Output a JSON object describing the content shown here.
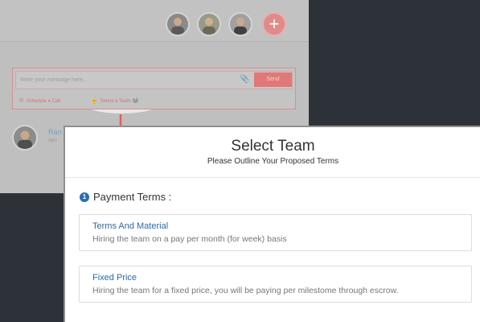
{
  "app": {
    "avatars": [
      "avatar-1",
      "avatar-2",
      "avatar-3"
    ],
    "add_icon": "+",
    "composer": {
      "placeholder": "Write your message here...",
      "send_label": "Send",
      "schedule_label": "Schedule a Call",
      "select_team_label": "Select a Team",
      "help_glyph": "?"
    },
    "comment": {
      "name": "Ran",
      "sub": "Apri"
    }
  },
  "modal": {
    "title": "Select Team",
    "subtitle": "Please Outline Your Proposed Terms",
    "section": {
      "step": "1",
      "heading": "Payment Terms :"
    },
    "options": [
      {
        "title": "Terms And Material",
        "description": "Hiring the team on a pay per month (for week) basis"
      },
      {
        "title": "Fixed Price",
        "description": "Hiring the team for a fixed price, you will be paying per milestome through escrow."
      }
    ]
  },
  "colors": {
    "accent": "#e07878",
    "link": "#2a6ba9",
    "badge": "#2b6cb0",
    "dark_bg": "#2d3238"
  }
}
